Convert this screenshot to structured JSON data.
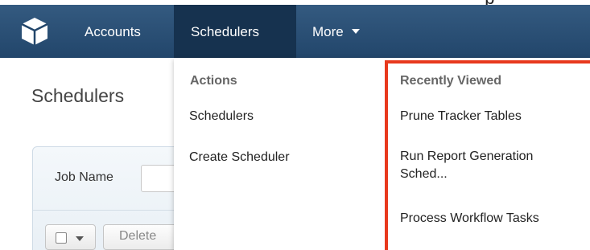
{
  "top_strip": {
    "partial_text": "p"
  },
  "nav": {
    "items": [
      {
        "label": "Accounts"
      },
      {
        "label": "Schedulers",
        "active": true
      },
      {
        "label": "More"
      }
    ]
  },
  "page": {
    "title": "Schedulers",
    "filter": {
      "job_name_label": "Job Name",
      "job_name_value": ""
    },
    "list_actions": {
      "delete_label": "Delete"
    }
  },
  "dropdown": {
    "actions": {
      "header": "Actions",
      "items": [
        {
          "label": "Schedulers"
        },
        {
          "label": "Create Scheduler"
        }
      ]
    },
    "recently_viewed": {
      "header": "Recently Viewed",
      "items": [
        {
          "label": "Prune Tracker Tables"
        },
        {
          "label": "Run Report Generation Sched..."
        },
        {
          "label": "Process Workflow Tasks"
        }
      ]
    }
  },
  "colors": {
    "navbar": "#22466b",
    "navbar_active": "#16324f",
    "highlight_border": "#e8391d"
  },
  "icons": {
    "logo": "cube-logo-icon",
    "more_caret": "caret-down-icon",
    "checkbox_caret": "caret-down-icon"
  }
}
